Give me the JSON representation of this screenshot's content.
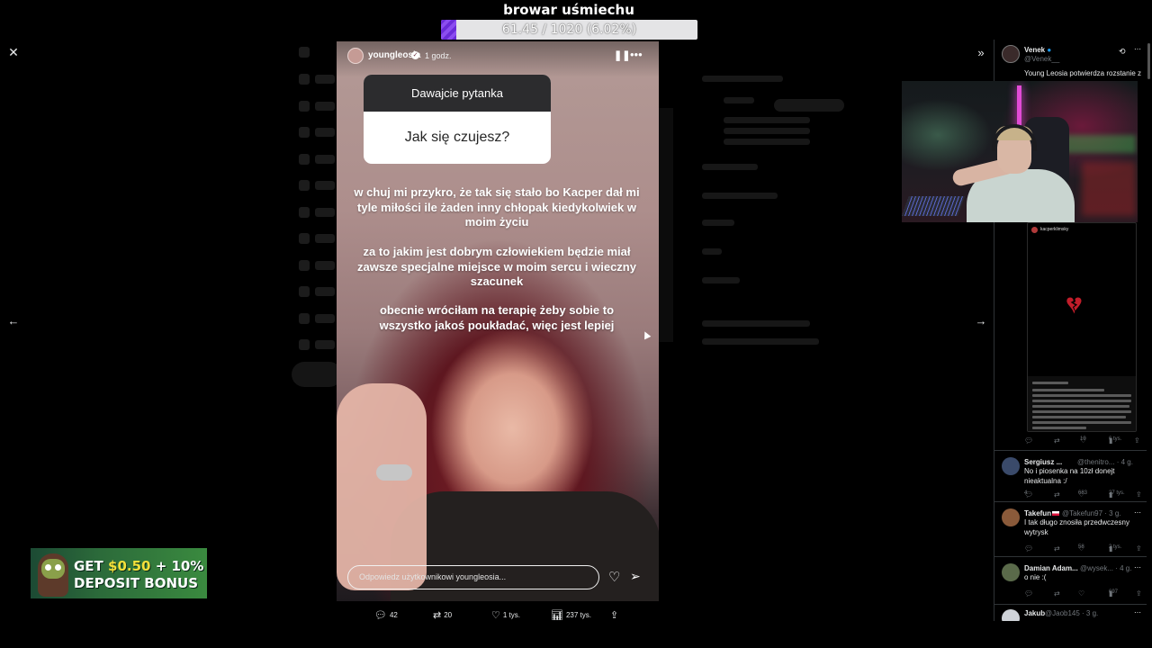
{
  "stream": {
    "title": "browar uśmiechu",
    "goal_text": "61.45 / 1020 (6.02%)",
    "goal_progress": 0.0602,
    "goal_color": "#7b3ae6"
  },
  "viewer": {
    "close_icon": "close-icon",
    "prev_icon": "arrow-left-icon",
    "next_icon": "arrow-right-icon",
    "collapse_icon": "collapse-panel-icon"
  },
  "story": {
    "username": "youngleosia",
    "time": "1 godz.",
    "question_header": "Dawajcie pytanka",
    "question": "Jak się czujesz?",
    "paragraphs": [
      "w chuj mi przykro, że tak się stało bo Kacper dał mi tyle miłości ile żaden inny chłopak kiedykolwiek w moim życiu",
      "za to jakim jest dobrym człowiekiem będzie miał zawsze specjalne miejsce w moim sercu i wieczny szacunek",
      "obecnie wróciłam na terapię żeby sobie to wszystko jakoś poukładać, więc jest lepiej"
    ],
    "reply_placeholder": "Odpowiedz użytkownikowi youngleosia..."
  },
  "post_actions": {
    "replies": "42",
    "reposts": "20",
    "likes": "1 tys.",
    "views": "237 tys."
  },
  "right_panel": {
    "top_tweet": {
      "name": "Venek",
      "handle": "@Venek__",
      "text": "Young Leosia potwierdza rozstanie z",
      "replies": "",
      "likes": "19",
      "views": "6 tys."
    },
    "embed": {
      "user": "kacperklimsky"
    },
    "replies": [
      {
        "name": "Sergiusz ...",
        "handle": "@thenitro... · 4 g.",
        "text": "No i piosenka na 10zł donejt nieaktualna :/",
        "replies": "4",
        "reposts": "",
        "likes": "683",
        "views": "27 tys."
      },
      {
        "name": "Takefun",
        "handle": "@Takefun97 · 3 g.",
        "text": "I tak długo znosiła przedwczesny wytrysk",
        "replies": "",
        "reposts": "",
        "likes": "58",
        "views": "2 tys."
      },
      {
        "name": "Damian Adam...",
        "handle": "@wysek... · 4 g.",
        "text": "o nie :(",
        "replies": "",
        "reposts": "",
        "likes": "",
        "views": "697"
      },
      {
        "name": "Jakub",
        "handle": "@Jaob145 · 3 g.",
        "text": ""
      }
    ]
  },
  "ad": {
    "line1_prefix": "GET ",
    "line1_highlight": "$0.50",
    "line1_suffix": " + 10%",
    "line2": "DEPOSIT BONUS"
  }
}
